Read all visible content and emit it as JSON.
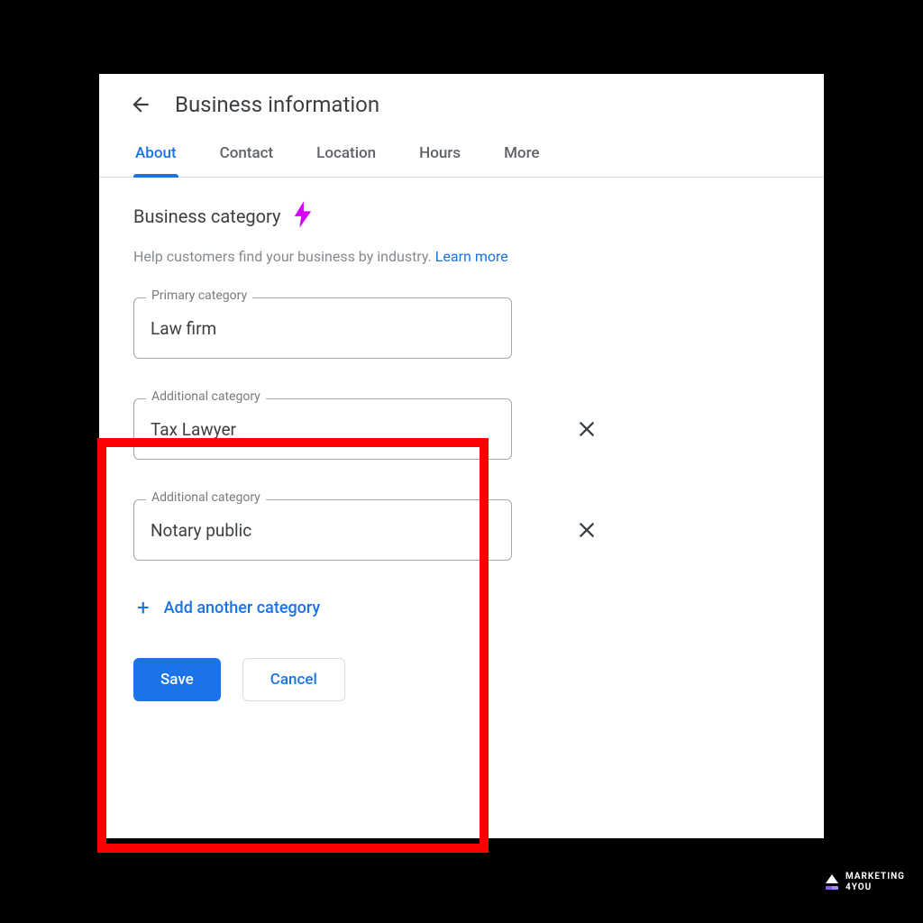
{
  "header": {
    "title": "Business information"
  },
  "tabs": [
    {
      "label": "About",
      "active": true
    },
    {
      "label": "Contact",
      "active": false
    },
    {
      "label": "Location",
      "active": false
    },
    {
      "label": "Hours",
      "active": false
    },
    {
      "label": "More",
      "active": false
    }
  ],
  "section": {
    "title": "Business category",
    "help_text": "Help customers find your business by industry. ",
    "learn_more": "Learn more"
  },
  "primary": {
    "label": "Primary category",
    "value": "Law firm"
  },
  "additional": [
    {
      "label": "Additional category",
      "value": "Tax Lawyer"
    },
    {
      "label": "Additional category",
      "value": "Notary public"
    }
  ],
  "add_another": "Add another category",
  "buttons": {
    "save": "Save",
    "cancel": "Cancel"
  },
  "watermark": {
    "line1": "MARKETING",
    "line2": "4YOU"
  }
}
